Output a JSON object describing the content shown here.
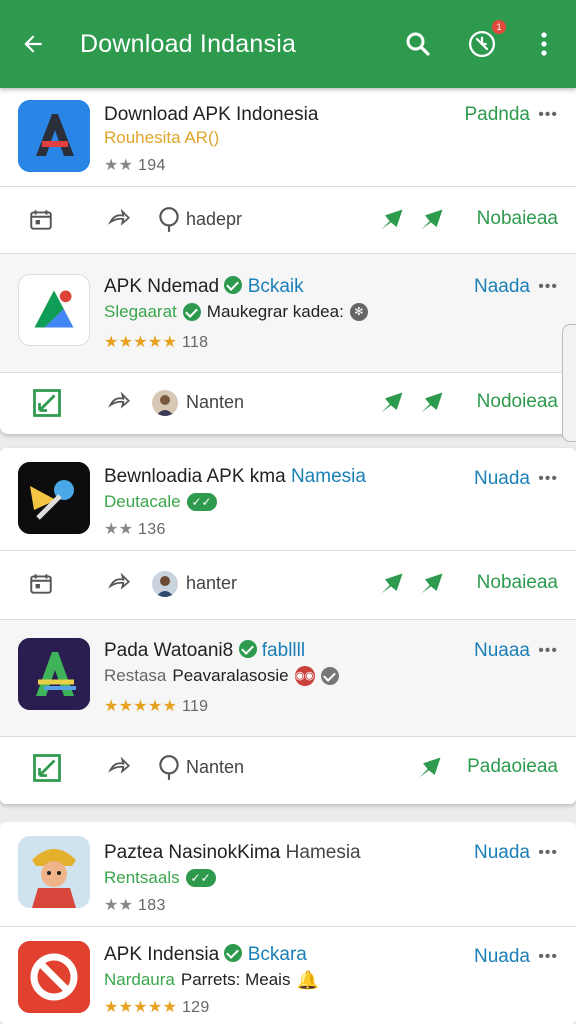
{
  "appbar": {
    "title": "Download Indansia",
    "notif_count": "1"
  },
  "apps": [
    {
      "name": "Download APK Indonesia",
      "sub": "Rouhesita AR()",
      "rating_stars": "★★",
      "rating_count": "194",
      "action": "Padnda",
      "more": "•••"
    },
    {
      "name": "APK Ndemad",
      "name_accent": "Bckaik",
      "sub": "Slegaarat",
      "sub_dark": "Maukegrar kadea:",
      "rating_stars": "★★★★★",
      "rating_count": "118",
      "action": "Naada",
      "more": "•••"
    },
    {
      "name": "Bewnloadia APK kma",
      "name_accent": "Namesia",
      "sub": "Deutacale",
      "rating_stars": "★★",
      "rating_count": "136",
      "action": "Nuada",
      "more": "•••"
    },
    {
      "name": "Pada Watoani8",
      "name_accent": "fabllll",
      "sub": "Restasa",
      "sub_dark": "Peavaralasosie",
      "rating_stars": "★★★★★",
      "rating_count": "119",
      "action": "Nuaaa",
      "more": "•••"
    },
    {
      "name": "Paztea NasinokKima",
      "name_accent": "Hamesia",
      "sub": "Rentsaals",
      "rating_stars": "★★",
      "rating_count": "183",
      "action": "Nuada",
      "more": "•••"
    },
    {
      "name": "APK Indensia",
      "name_accent": "Bckara",
      "sub": "Nardaura",
      "sub_dark": "Parrets: Meais",
      "rating_stars": "★★★★★",
      "rating_count": "129",
      "action": "Nuada",
      "more": "•••"
    }
  ],
  "action_rows": [
    {
      "label": "hadерr",
      "right": "Nobaieaa"
    },
    {
      "label": "Nanten",
      "right": "Nodoieaa"
    },
    {
      "label": "hanter",
      "right": "Nobaieaa"
    },
    {
      "label": "Nanten",
      "right": "Padaoieaa"
    }
  ],
  "colors": {
    "primary": "#2e9a4e",
    "accent": "#1b7fb7",
    "star": "#e6a21e"
  },
  "icons": [
    "back-arrow-icon",
    "search-icon",
    "no-clock-icon",
    "more-vert-icon",
    "calendar-icon",
    "share-arrow-icon",
    "search-lens-icon",
    "send-icon"
  ]
}
